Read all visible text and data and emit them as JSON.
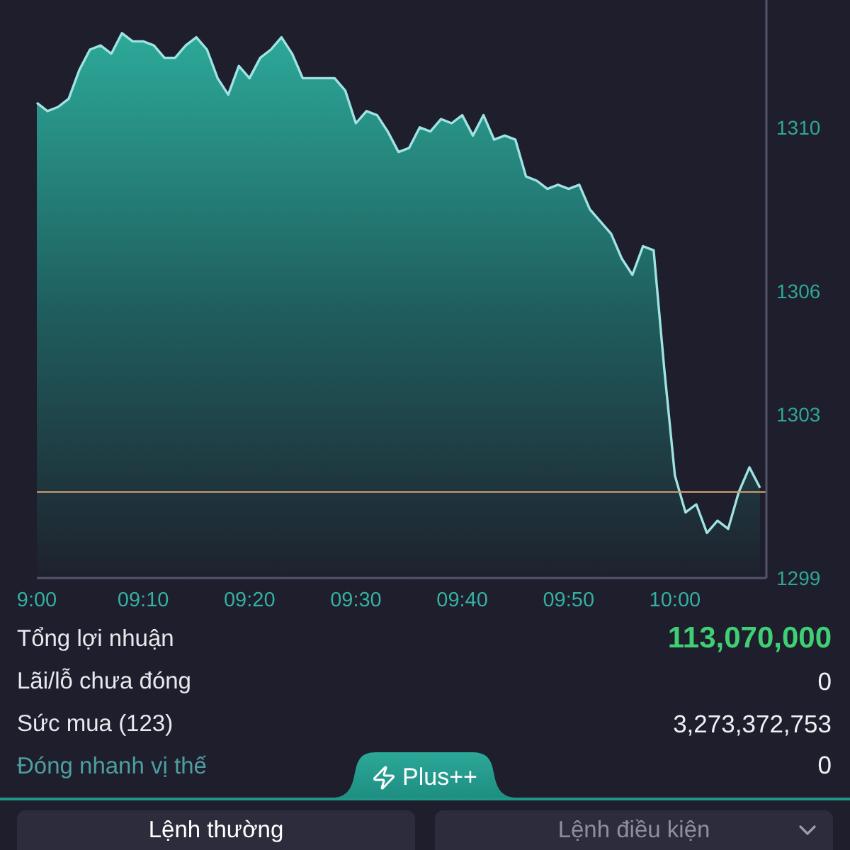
{
  "chart": {
    "chart_data": {
      "type": "area",
      "categories": [
        "9:00",
        null,
        null,
        null,
        null,
        null,
        null,
        null,
        null,
        null,
        "09:10",
        null,
        null,
        null,
        null,
        null,
        null,
        null,
        null,
        null,
        "09:20",
        null,
        null,
        null,
        null,
        null,
        null,
        null,
        null,
        null,
        "09:30",
        null,
        null,
        null,
        null,
        null,
        null,
        null,
        null,
        null,
        "09:40",
        null,
        null,
        null,
        null,
        null,
        null,
        null,
        null,
        null,
        "09:50",
        null,
        null,
        null,
        null,
        null,
        null,
        null,
        null,
        null,
        "10:00",
        null,
        null,
        null,
        null,
        null,
        null,
        null,
        null
      ],
      "series": [
        {
          "color": "#9fe3e3",
          "values": [
            1310.6,
            1310.4,
            1310.5,
            1310.7,
            1311.4,
            1311.9,
            1312.0,
            1311.8,
            1312.3,
            1312.1,
            1312.1,
            1312.0,
            1311.7,
            1311.7,
            1312.0,
            1312.2,
            1311.9,
            1311.2,
            1310.8,
            1311.5,
            1311.2,
            1311.7,
            1311.9,
            1312.2,
            1311.8,
            1311.2,
            1311.2,
            1311.2,
            1311.2,
            1310.9,
            1310.1,
            1310.4,
            1310.3,
            1309.9,
            1309.4,
            1309.5,
            1310.0,
            1309.9,
            1310.2,
            1310.1,
            1310.3,
            1309.8,
            1310.3,
            1309.7,
            1309.8,
            1309.7,
            1308.8,
            1308.7,
            1308.5,
            1308.6,
            1308.5,
            1308.6,
            1308.0,
            1307.7,
            1307.4,
            1306.8,
            1306.4,
            1307.1,
            1307.0,
            1304.1,
            1301.5,
            1300.6,
            1300.8,
            1300.1,
            1300.4,
            1300.2,
            1301.1,
            1301.7,
            1301.2
          ]
        }
      ],
      "ylim": [
        1299,
        1313.11
      ],
      "yticks": [
        1310,
        1306,
        1303,
        1299
      ],
      "ref_lines": [
        {
          "axis": "y",
          "value": 1301.1
        }
      ]
    }
  },
  "summary": [
    {
      "kind": "total",
      "label": "Tổng lợi nhuận",
      "value": "113,070,000"
    },
    {
      "kind": "plain",
      "label": "Lãi/lỗ chưa đóng",
      "value": "0"
    },
    {
      "kind": "plain",
      "label": "Sức mua (123)",
      "value": "3,273,372,753"
    }
  ],
  "quick_close": {
    "label": "Đóng nhanh vị thế",
    "value": "0"
  },
  "plus_tab": {
    "label": "Plus++"
  },
  "order_types": [
    {
      "label": "Lệnh thường",
      "selected": true,
      "dropdown": false
    },
    {
      "label": "Lệnh điều kiện",
      "selected": false,
      "dropdown": true
    }
  ]
}
